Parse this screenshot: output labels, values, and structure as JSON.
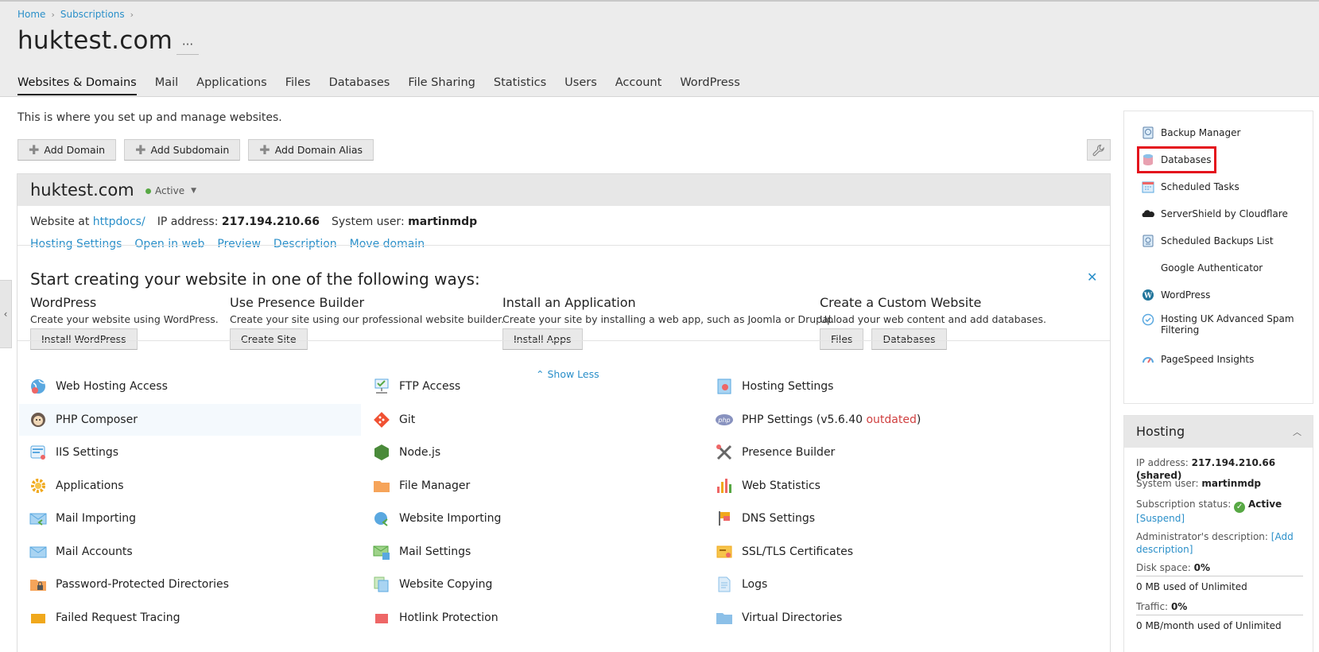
{
  "breadcrumb": {
    "home": "Home",
    "subscriptions": "Subscriptions"
  },
  "page": {
    "title": "huktest.com",
    "more": "···"
  },
  "tabs": [
    {
      "label": "Websites & Domains"
    },
    {
      "label": "Mail"
    },
    {
      "label": "Applications"
    },
    {
      "label": "Files"
    },
    {
      "label": "Databases"
    },
    {
      "label": "File Sharing"
    },
    {
      "label": "Statistics"
    },
    {
      "label": "Users"
    },
    {
      "label": "Account"
    },
    {
      "label": "WordPress"
    }
  ],
  "intro": "This is where you set up and manage websites.",
  "toolbar": {
    "add_domain": "Add Domain",
    "add_subdomain": "Add Subdomain",
    "add_alias": "Add Domain Alias"
  },
  "domain": {
    "name": "huktest.com",
    "status": "Active",
    "website_at_label": "Website at",
    "website_at_link": "httpdocs/",
    "ip_label": "IP address:",
    "ip": "217.194.210.66",
    "sysuser_label": "System user:",
    "sysuser": "martinmdp",
    "links": [
      "Hosting Settings",
      "Open in web",
      "Preview",
      "Description",
      "Move domain"
    ]
  },
  "start": {
    "title": "Start creating your website in one of the following ways:",
    "wordpress": {
      "heading": "WordPress",
      "desc": "Create your website using WordPress.",
      "button": "Install WordPress"
    },
    "presence": {
      "heading": "Use Presence Builder",
      "desc": "Create your site using our professional website builder.",
      "button": "Create Site"
    },
    "app": {
      "heading": "Install an Application",
      "desc": "Create your site by installing a web app, such as Joomla or Drupal.",
      "button": "Install Apps"
    },
    "custom": {
      "heading": "Create a Custom Website",
      "desc": "Upload your web content and add databases.",
      "button_files": "Files",
      "button_db": "Databases"
    },
    "show_less": "Show Less"
  },
  "tools": {
    "col1": [
      "Web Hosting Access",
      "PHP Composer",
      "IIS Settings",
      "Applications",
      "Mail Importing",
      "Mail Accounts",
      "Password-Protected Directories",
      "Failed Request Tracing"
    ],
    "col2": [
      "FTP Access",
      "Git",
      "Node.js",
      "File Manager",
      "Website Importing",
      "Mail Settings",
      "Website Copying",
      "Hotlink Protection"
    ],
    "col3": [
      "Hosting Settings",
      "PHP Settings (v5.6.40 ",
      "Presence Builder",
      "Web Statistics",
      "DNS Settings",
      "SSL/TLS Certificates",
      "Logs",
      "Virtual Directories"
    ],
    "php_outdated": "outdated",
    "php_close": ")"
  },
  "side": {
    "items": [
      "Backup Manager",
      "Databases",
      "Scheduled Tasks",
      "ServerShield by Cloudflare",
      "Scheduled Backups List",
      "Google Authenticator",
      "WordPress",
      "Hosting UK Advanced Spam Filtering",
      "PageSpeed Insights"
    ]
  },
  "hosting": {
    "title": "Hosting",
    "ip_label": "IP address:",
    "ip_value": "217.194.210.66 (shared)",
    "sysuser_label": "System user:",
    "sysuser_value": "martinmdp",
    "status_label": "Subscription status:",
    "status_value": "Active",
    "suspend": "[Suspend]",
    "admin_desc_label": "Administrator's description:",
    "admin_desc_link": "[Add description]",
    "disk_label": "Disk space:",
    "disk_value": "0%",
    "disk_used": "0 MB used of Unlimited",
    "traffic_label": "Traffic:",
    "traffic_value": "0%",
    "traffic_used": "0 MB/month used of Unlimited"
  }
}
